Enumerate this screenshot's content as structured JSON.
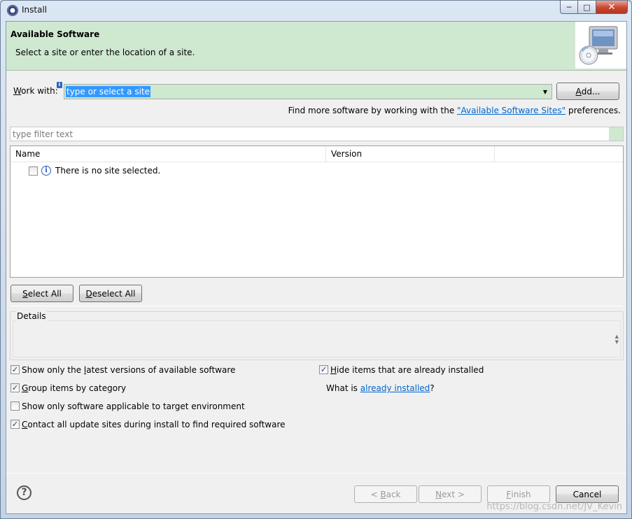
{
  "window": {
    "title": "Install"
  },
  "header": {
    "title": "Available Software",
    "description": "Select a site or enter the location of a site."
  },
  "work_with": {
    "label_prefix": "W",
    "label_rest": "ork with:",
    "value": "type or select a site",
    "add_button_prefix": "A",
    "add_button_rest": "dd..."
  },
  "more_software": {
    "text_before": "Find more software by working with the ",
    "link": "\"Available Software Sites\"",
    "text_after": " preferences."
  },
  "filter": {
    "placeholder": "type filter text"
  },
  "table": {
    "columns": [
      "Name",
      "Version"
    ],
    "rows": [
      {
        "label": "There is no site selected.",
        "checked": false
      }
    ]
  },
  "selection_buttons": {
    "select_all_prefix": "S",
    "select_all_rest": "elect All",
    "deselect_all_prefix": "D",
    "deselect_all_rest": "eselect All"
  },
  "details": {
    "label": "Details"
  },
  "options": {
    "latest_versions": {
      "before": "Show only the ",
      "mnemonic": "l",
      "after": "atest versions of available software",
      "checked": true
    },
    "hide_installed": {
      "mnemonic": "H",
      "after": "ide items that are already installed",
      "checked": true
    },
    "group_by_category": {
      "mnemonic": "G",
      "after": "roup items by category",
      "checked": true
    },
    "what_is": {
      "before": "What is ",
      "link": "already installed",
      "after": "?"
    },
    "target_environment": {
      "label": "Show only software applicable to target environment",
      "checked": false
    },
    "contact_sites": {
      "mnemonic": "C",
      "after": "ontact all update sites during install to find required software",
      "checked": true
    }
  },
  "footer": {
    "back_prefix": "< ",
    "back_mnemonic": "B",
    "back_rest": "ack",
    "next_mnemonic": "N",
    "next_rest": "ext >",
    "finish_mnemonic": "F",
    "finish_rest": "inish",
    "cancel": "Cancel"
  },
  "watermark": "https://blog.csdn.net/JV_Kevin",
  "icons": {
    "app": "eclipse-icon",
    "help": "help-icon",
    "info": "info-icon",
    "header": "monitor-cd-icon"
  }
}
